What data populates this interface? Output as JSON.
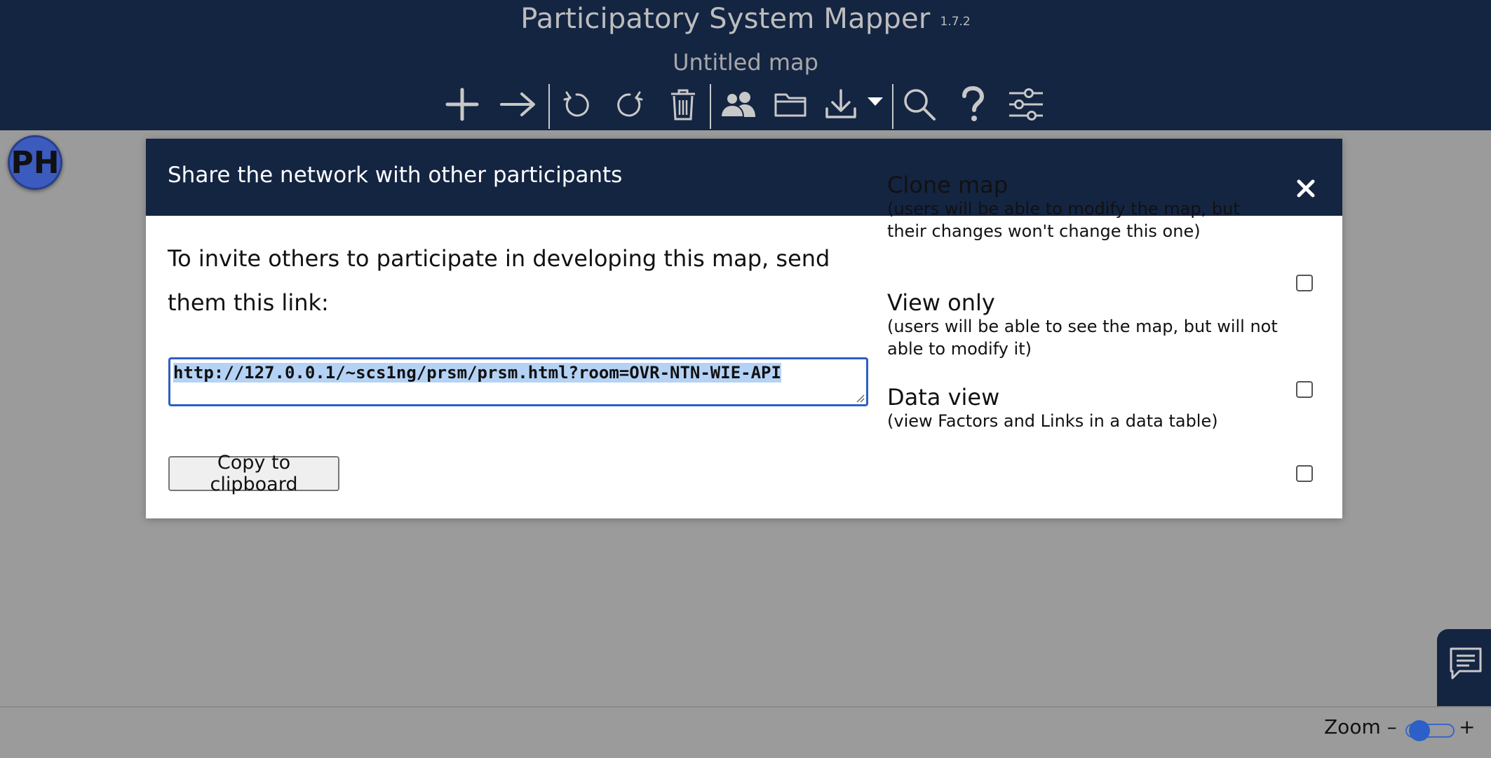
{
  "app": {
    "title": "Participatory System Mapper",
    "version": "1.7.2",
    "map_title": "Untitled map"
  },
  "toolbar": [
    {
      "name": "add-factor-icon"
    },
    {
      "name": "add-link-icon"
    },
    {
      "name": "undo-icon"
    },
    {
      "name": "redo-icon"
    },
    {
      "name": "delete-icon"
    },
    {
      "name": "share-users-icon"
    },
    {
      "name": "open-folder-icon"
    },
    {
      "name": "download-icon"
    },
    {
      "name": "search-icon"
    },
    {
      "name": "help-icon"
    },
    {
      "name": "settings-sliders-icon"
    }
  ],
  "avatar": {
    "initials": "PH",
    "color": "#3b5bbf"
  },
  "dialog": {
    "title": "Share the network with other participants",
    "invite_text": "To invite others to participate in developing this map, send them this link:",
    "link": "http://127.0.0.1/~scs1ng/prsm/prsm.html?room=OVR-NTN-WIE-API",
    "copy_label": "Copy to clipboard",
    "options": [
      {
        "title": "Clone map",
        "description": "(users will be able to modify the map, but their changes won't change this one)",
        "checked": false
      },
      {
        "title": "View only",
        "description": "(users will be able to see the map, but will not able to modify it)",
        "checked": false
      },
      {
        "title": "Data view",
        "description": "(view Factors and Links in a data table)",
        "checked": false
      }
    ]
  },
  "zoom": {
    "label": "Zoom –",
    "plus": "+",
    "level": 0.1
  },
  "colors": {
    "header": "#142542",
    "canvas": "#9b9b9b",
    "accent": "#2c5fc7",
    "selection": "#b4d2f5"
  }
}
